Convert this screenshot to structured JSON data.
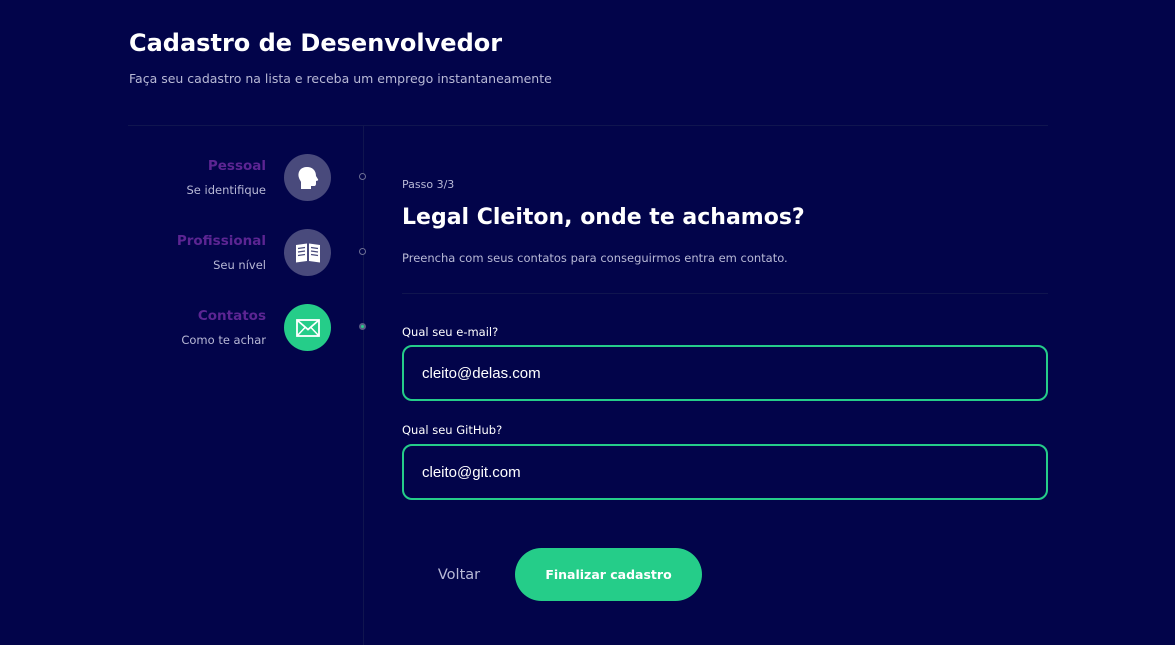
{
  "header": {
    "title": "Cadastro de Desenvolvedor",
    "subtitle": "Faça seu cadastro na lista e receba um emprego instantaneamente"
  },
  "steps": [
    {
      "label": "Pessoal",
      "desc": "Se identifique",
      "icon": "person-head-icon",
      "active": false
    },
    {
      "label": "Profissional",
      "desc": "Seu nível",
      "icon": "book-icon",
      "active": false
    },
    {
      "label": "Contatos",
      "desc": "Como te achar",
      "icon": "envelope-icon",
      "active": true
    }
  ],
  "main": {
    "step_indicator": "Passo 3/3",
    "heading": "Legal Cleiton, onde te achamos?",
    "lead": "Preencha com seus contatos para conseguirmos entra em contato."
  },
  "form": {
    "email_label": "Qual seu e-mail?",
    "email_value": "cleito@delas.com",
    "github_label": "Qual seu GitHub?",
    "github_value": "cleito@git.com"
  },
  "buttons": {
    "back_label": "Voltar",
    "finish_label": "Finalizar cadastro"
  },
  "colors": {
    "background": "#02044a",
    "accent": "#25cd89",
    "step_label": "#5c2593",
    "inactive_circle": "#494a7c",
    "muted_text": "#b8b9d6"
  }
}
